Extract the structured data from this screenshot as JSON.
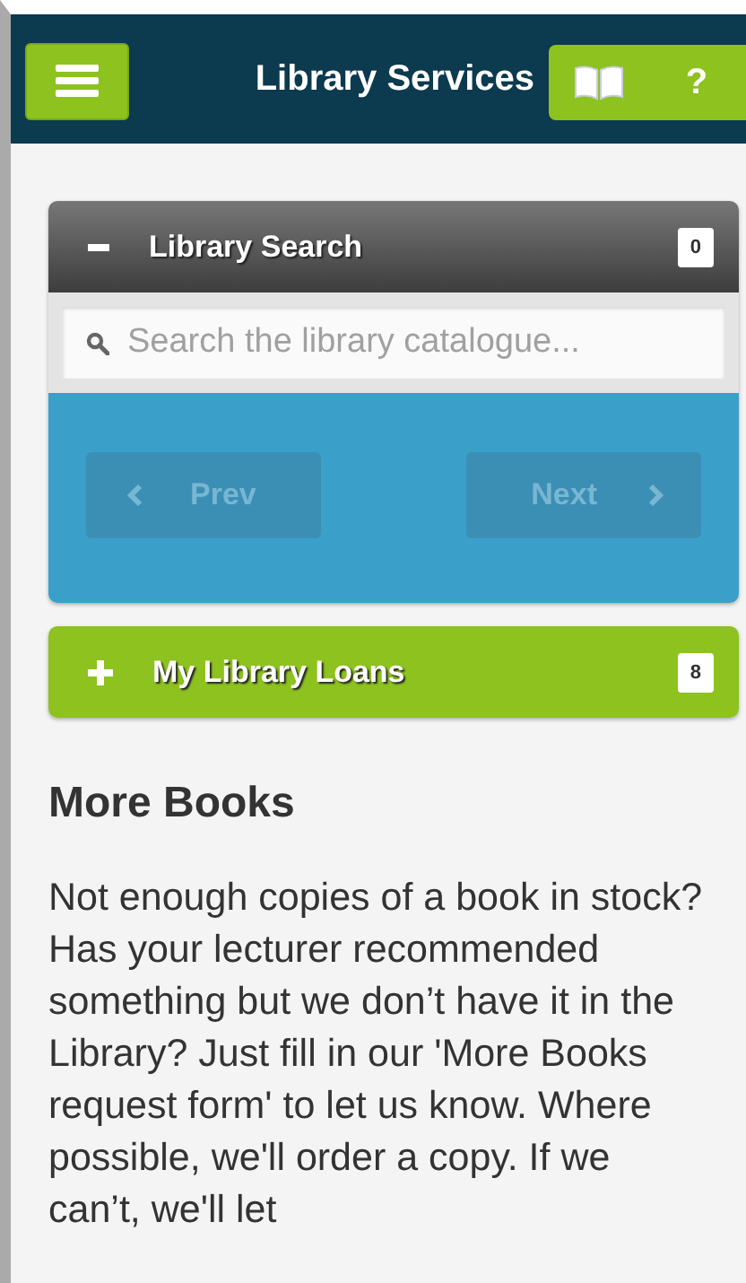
{
  "header": {
    "title": "Library Services",
    "help_label": "?"
  },
  "panels": [
    {
      "kind": "search",
      "title": "Library Search",
      "count": "0",
      "expanded": true,
      "search": {
        "placeholder": "Search the library catalogue..."
      },
      "buttons": [
        {
          "label": "Prev",
          "kind": "prev",
          "disabled": true
        },
        {
          "label": "Next",
          "kind": "next",
          "disabled": true
        }
      ]
    },
    {
      "kind": "loans",
      "title": "My Library Loans",
      "count": "8",
      "expanded": false
    }
  ],
  "article": {
    "heading": "More Books",
    "body": "Not enough copies of a book in stock? Has your lecturer recommended something but we don’t have it in the Library? Just fill in our 'More Books request form' to let us know. Where possible, we'll order a copy. If we can’t, we'll let"
  }
}
